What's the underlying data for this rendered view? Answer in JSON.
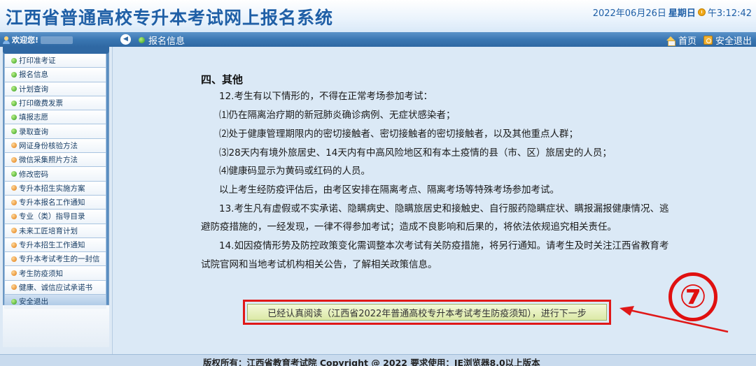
{
  "header": {
    "title": "江西省普通高校专升本考试网上报名系统",
    "date": "2022年06月26日",
    "weekday": "星期日",
    "time": "午3:12:42"
  },
  "navbar": {
    "welcome": "欢迎您!",
    "current_page": "报名信息",
    "home_label": "首页",
    "exit_label": "安全退出"
  },
  "sidebar": {
    "items": [
      {
        "label": "打印准考证",
        "icon": "green-dot-icon"
      },
      {
        "label": "报名信息",
        "icon": "green-dot-icon"
      },
      {
        "label": "计划查询",
        "icon": "green-dot-icon"
      },
      {
        "label": "打印缴费发票",
        "icon": "green-dot-icon"
      },
      {
        "label": "填报志愿",
        "icon": "green-dot-icon"
      },
      {
        "label": "录取查询",
        "icon": "green-dot-icon"
      },
      {
        "label": "网证身份核验方法",
        "icon": "orange-dot-icon"
      },
      {
        "label": "微信采集照片方法",
        "icon": "orange-dot-icon"
      },
      {
        "label": "修改密码",
        "icon": "green-dot-icon"
      },
      {
        "label": "专升本招生实施方案",
        "icon": "orange-dot-icon"
      },
      {
        "label": "专升本报名工作通知",
        "icon": "orange-dot-icon"
      },
      {
        "label": "专业（类）指导目录",
        "icon": "orange-dot-icon"
      },
      {
        "label": "未来工匠培育计划",
        "icon": "orange-dot-icon"
      },
      {
        "label": "专升本招生工作通知",
        "icon": "orange-dot-icon"
      },
      {
        "label": "专升本考试考生的一封信",
        "icon": "orange-dot-icon"
      },
      {
        "label": "考生防疫须知",
        "icon": "orange-dot-icon"
      },
      {
        "label": "健康、诚信应试承诺书",
        "icon": "orange-dot-icon"
      },
      {
        "label": "安全退出",
        "icon": "green-dot-icon"
      }
    ]
  },
  "content": {
    "section_title": "四、其他",
    "paragraphs": [
      "12.考生有以下情形的，不得在正常考场参加考试：",
      "⑴仍在隔离治疗期的新冠肺炎确诊病例、无症状感染者；",
      "⑵处于健康管理期限内的密切接触者、密切接触者的密切接触者，以及其他重点人群；",
      "⑶28天内有境外旅居史、14天内有中高风险地区和有本土疫情的县（市、区）旅居史的人员；",
      "⑷健康码显示为黄码或红码的人员。",
      "以上考生经防疫评估后，由考区安排在隔离考点、隔离考场等特殊考场参加考试。",
      "13.考生凡有虚假或不实承诺、隐瞒病史、隐瞒旅居史和接触史、自行服药隐瞒症状、瞒报漏报健康情况、逃",
      "避防疫措施的，一经发现，一律不得参加考试；造成不良影响和后果的，将依法依规追究相关责任。",
      "14.如因疫情形势及防控政策变化需调整本次考试有关防疫措施，将另行通知。请考生及时关注江西省教育考",
      "试院官网和当地考试机构相关公告，了解相关政策信息。"
    ],
    "proceed_button": "已经认真阅读（江西省2022年普通高校专升本考试考生防疫须知），进行下一步",
    "annotation": "⑦"
  },
  "footer": {
    "text": "版权所有：江西省教育考试院 Copyright @ 2022 要求使用：IE浏览器8.0以上版本"
  },
  "colors": {
    "title_blue": "#1f5fa6",
    "nav_blue": "#3a77b3",
    "highlight_red": "#e01818",
    "button_green": "#dbe9a6"
  }
}
